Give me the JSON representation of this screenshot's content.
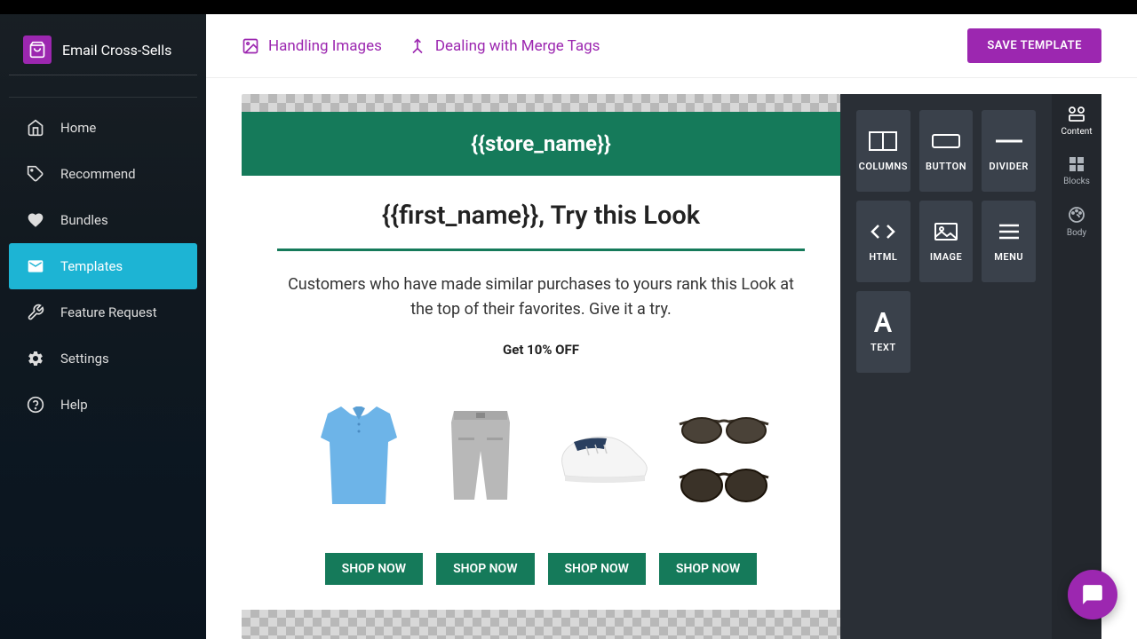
{
  "brand": {
    "title": "Email Cross-Sells"
  },
  "nav": {
    "items": [
      {
        "label": "Home"
      },
      {
        "label": "Recommend"
      },
      {
        "label": "Bundles"
      },
      {
        "label": "Templates"
      },
      {
        "label": "Feature Request"
      },
      {
        "label": "Settings"
      },
      {
        "label": "Help"
      }
    ]
  },
  "topbar": {
    "link1": "Handling Images",
    "link2": "Dealing with Merge Tags",
    "save": "SAVE TEMPLATE"
  },
  "email": {
    "store": "{{store_name}}",
    "headline": "{{first_name}}, Try this Look",
    "body": "Customers who have made similar purchases to yours rank this Look at the top of their favorites. Give it a try.",
    "offer": "Get 10% OFF",
    "shop": "SHOP NOW"
  },
  "blocks": {
    "columns": "COLUMNS",
    "button": "BUTTON",
    "divider": "DIVIDER",
    "html": "HTML",
    "image": "IMAGE",
    "menu": "MENU",
    "text": "TEXT"
  },
  "rtabs": {
    "content": "Content",
    "blocks": "Blocks",
    "body": "Body"
  }
}
